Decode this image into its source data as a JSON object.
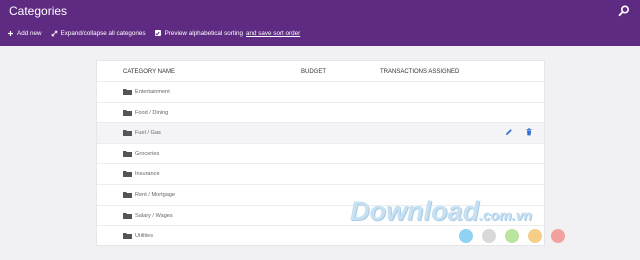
{
  "header": {
    "title": "Categories"
  },
  "toolbar": {
    "add_new": "Add new",
    "expand_collapse": "Expand/collapse all categories",
    "preview_sort": "Preview alphabetical sorting",
    "save_sort": "and save sort order"
  },
  "table": {
    "columns": [
      "CATEGORY NAME",
      "BUDGET",
      "TRANSACTIONS ASSIGNED"
    ],
    "rows": [
      {
        "name": "Entertainment"
      },
      {
        "name": "Food / Dining"
      },
      {
        "name": "Fuel / Gas"
      },
      {
        "name": "Groceries"
      },
      {
        "name": "Insurance"
      },
      {
        "name": "Rent / Mortgage"
      },
      {
        "name": "Salary / Wages"
      },
      {
        "name": "Utilities"
      }
    ]
  },
  "icons": {
    "search": "search-icon",
    "add": "plus-icon",
    "expand": "expand-arrows-icon",
    "checkbox": "checkbox-checked-icon",
    "folder": "folder-icon",
    "edit": "pencil-icon",
    "delete": "trash-icon"
  },
  "watermark": {
    "brand": "Download",
    "domain": ".com.vn"
  },
  "colors": {
    "header_bg": "#5f2a82",
    "action_blue": "#2e6fd6",
    "page_bg": "#f1f1f3",
    "dots": [
      "#8fd3f0",
      "#d9d9d9",
      "#b9e59c",
      "#f5cf87",
      "#f2a0a0"
    ]
  }
}
